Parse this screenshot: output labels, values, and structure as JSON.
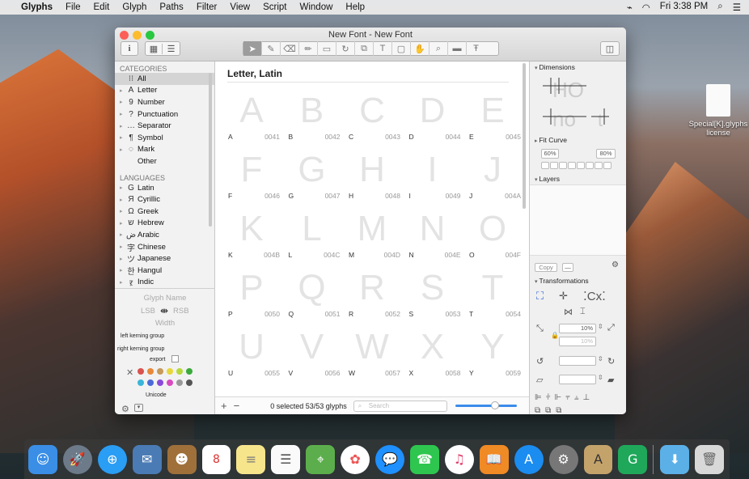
{
  "menubar": {
    "apple": "",
    "app": "Glyphs",
    "items": [
      "File",
      "Edit",
      "Glyph",
      "Paths",
      "Filter",
      "View",
      "Script",
      "Window",
      "Help"
    ],
    "clock": "Fri 3:38 PM"
  },
  "window": {
    "title": "New Font - New Font"
  },
  "sidebar": {
    "categories_header": "CATEGORIES",
    "categories": [
      {
        "icon": "⁝⁝",
        "label": "All"
      },
      {
        "icon": "A",
        "label": "Letter"
      },
      {
        "icon": "9",
        "label": "Number"
      },
      {
        "icon": "?",
        "label": "Punctuation"
      },
      {
        "icon": "…",
        "label": "Separator"
      },
      {
        "icon": "¶",
        "label": "Symbol"
      },
      {
        "icon": "◌",
        "label": "Mark"
      },
      {
        "icon": "",
        "label": "Other"
      }
    ],
    "languages_header": "LANGUAGES",
    "languages": [
      {
        "icon": "G",
        "label": "Latin"
      },
      {
        "icon": "Я",
        "label": "Cyrillic"
      },
      {
        "icon": "Ω",
        "label": "Greek"
      },
      {
        "icon": "ש",
        "label": "Hebrew"
      },
      {
        "icon": "ض",
        "label": "Arabic"
      },
      {
        "icon": "字",
        "label": "Chinese"
      },
      {
        "icon": "ツ",
        "label": "Japanese"
      },
      {
        "icon": "한",
        "label": "Hangul"
      },
      {
        "icon": "ऱ",
        "label": "Indic"
      }
    ]
  },
  "glyph_info": {
    "name_placeholder": "Glyph Name",
    "lsb": "LSB",
    "rsb": "RSB",
    "width": "Width",
    "left_kerning": "left kerning group",
    "right_kerning": "right kerning group",
    "export": "export",
    "unicode": "Unicode",
    "colors": [
      "#d9534f",
      "#e8893a",
      "#c79a59",
      "#e8d73a",
      "#b5d93a",
      "#3aaa3a",
      "#3ab5d9",
      "#4a6ad9",
      "#8a4ad9",
      "#d94ac0",
      "#999999",
      "#555555"
    ]
  },
  "main": {
    "header": "Letter, Latin",
    "glyphs": [
      {
        "char": "A",
        "name": "A",
        "code": "0041"
      },
      {
        "char": "B",
        "name": "B",
        "code": "0042"
      },
      {
        "char": "C",
        "name": "C",
        "code": "0043"
      },
      {
        "char": "D",
        "name": "D",
        "code": "0044"
      },
      {
        "char": "E",
        "name": "E",
        "code": "0045"
      },
      {
        "char": "F",
        "name": "F",
        "code": "0046"
      },
      {
        "char": "G",
        "name": "G",
        "code": "0047"
      },
      {
        "char": "H",
        "name": "H",
        "code": "0048"
      },
      {
        "char": "I",
        "name": "I",
        "code": "0049"
      },
      {
        "char": "J",
        "name": "J",
        "code": "004A"
      },
      {
        "char": "K",
        "name": "K",
        "code": "004B"
      },
      {
        "char": "L",
        "name": "L",
        "code": "004C"
      },
      {
        "char": "M",
        "name": "M",
        "code": "004D"
      },
      {
        "char": "N",
        "name": "N",
        "code": "004E"
      },
      {
        "char": "O",
        "name": "O",
        "code": "004F"
      },
      {
        "char": "P",
        "name": "P",
        "code": "0050"
      },
      {
        "char": "Q",
        "name": "Q",
        "code": "0051"
      },
      {
        "char": "R",
        "name": "R",
        "code": "0052"
      },
      {
        "char": "S",
        "name": "S",
        "code": "0053"
      },
      {
        "char": "T",
        "name": "T",
        "code": "0054"
      },
      {
        "char": "U",
        "name": "U",
        "code": "0055"
      },
      {
        "char": "V",
        "name": "V",
        "code": "0056"
      },
      {
        "char": "W",
        "name": "W",
        "code": "0057"
      },
      {
        "char": "X",
        "name": "X",
        "code": "0058"
      },
      {
        "char": "Y",
        "name": "Y",
        "code": "0059"
      }
    ],
    "status": "0 selected 53/53 glyphs",
    "search_placeholder": "Search"
  },
  "panel": {
    "dimensions": "Dimensions",
    "fit_curve": "Fit Curve",
    "fit_left": "60%",
    "fit_right": "80%",
    "layers": "Layers",
    "copy": "Copy",
    "minus": "—",
    "transformations": "Transformations",
    "scale": "10%",
    "scale2": "10%"
  },
  "desktop": {
    "file_label": "Special[K].glyphs license"
  }
}
